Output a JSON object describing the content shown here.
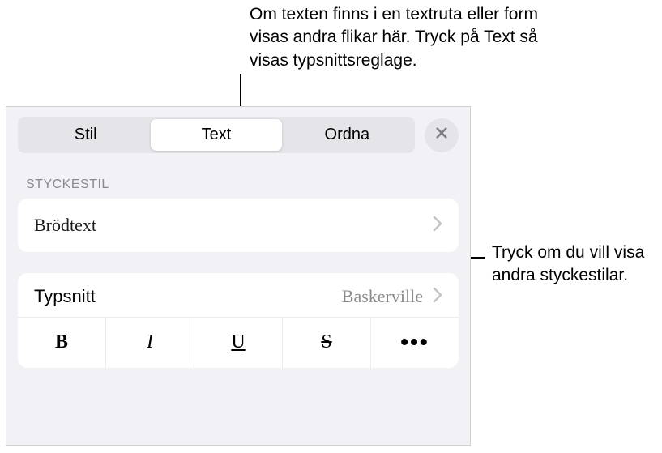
{
  "annotations": {
    "top": "Om texten finns i en textruta eller form visas andra flikar här. Tryck på Text så visas typsnittsreglage.",
    "right": "Tryck om du vill visa andra styckestilar."
  },
  "tabs": {
    "style": "Stil",
    "text": "Text",
    "arrange": "Ordna"
  },
  "sections": {
    "paragraph_style_header": "STYCKESTIL",
    "paragraph_style_value": "Brödtext",
    "font_label": "Typsnitt",
    "font_value": "Baskerville"
  },
  "style_buttons": {
    "bold": "B",
    "italic": "I",
    "underline": "U",
    "strike": "S",
    "more": "•••"
  }
}
